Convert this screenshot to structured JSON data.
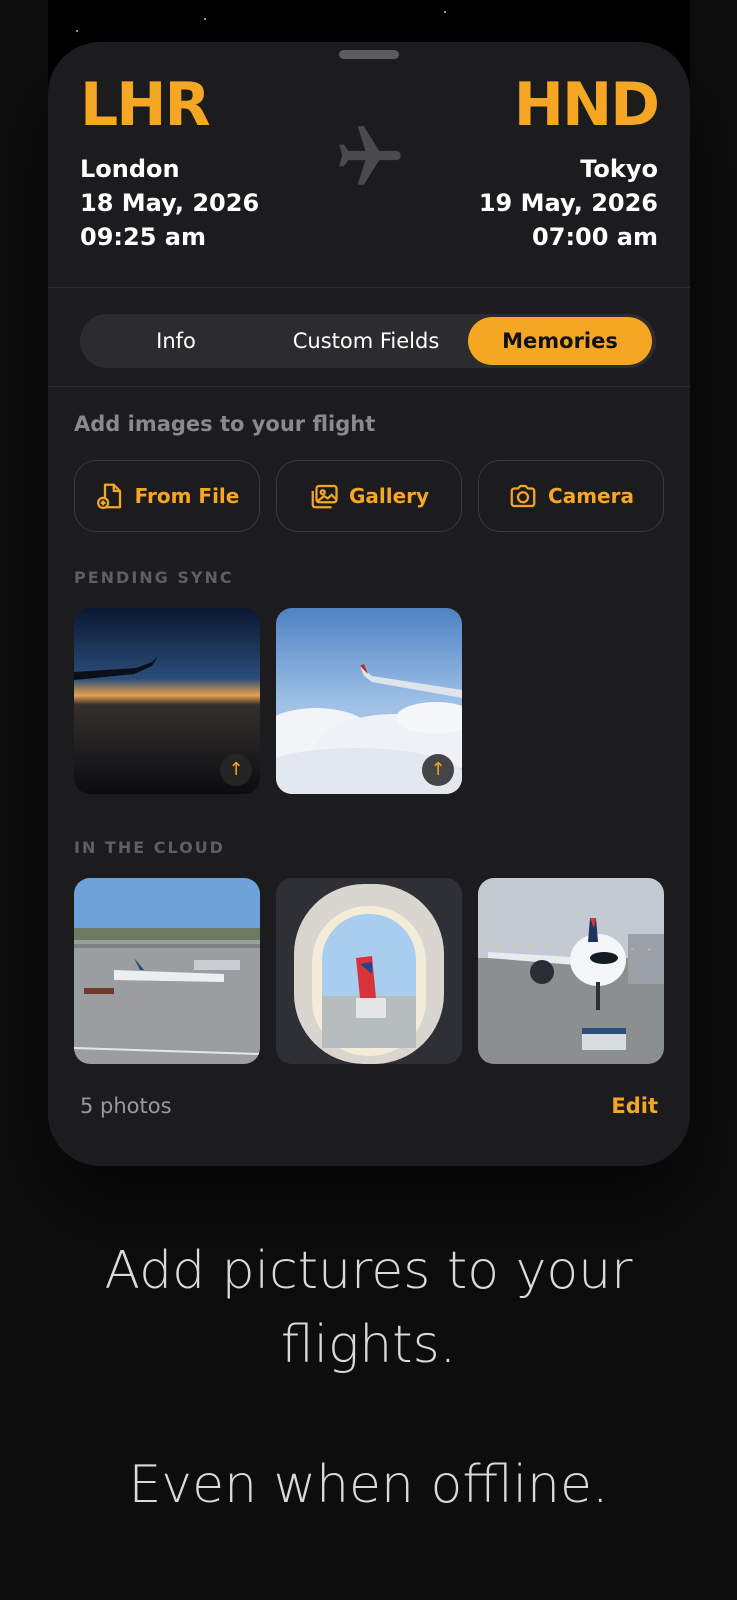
{
  "flight": {
    "origin": {
      "code": "LHR",
      "city": "London",
      "date": "18 May, 2026",
      "time": "09:25 am"
    },
    "destination": {
      "code": "HND",
      "city": "Tokyo",
      "date": "19 May, 2026",
      "time": "07:00 am"
    }
  },
  "tabs": [
    {
      "label": "Info",
      "selected": false
    },
    {
      "label": "Custom Fields",
      "selected": false
    },
    {
      "label": "Memories",
      "selected": true
    }
  ],
  "memories": {
    "hint": "Add images to your flight",
    "actions": {
      "from_file": "From File",
      "gallery": "Gallery",
      "camera": "Camera"
    },
    "pending_title": "PENDING SYNC",
    "cloud_title": "IN THE CLOUD",
    "photo_count": "5 photos",
    "edit_label": "Edit"
  },
  "tagline": {
    "line1": "Add pictures to your flights.",
    "line2": "Even when offline."
  },
  "colors": {
    "accent": "#f5a623",
    "card": "#1c1c1e",
    "background": "#0d0d0e"
  }
}
